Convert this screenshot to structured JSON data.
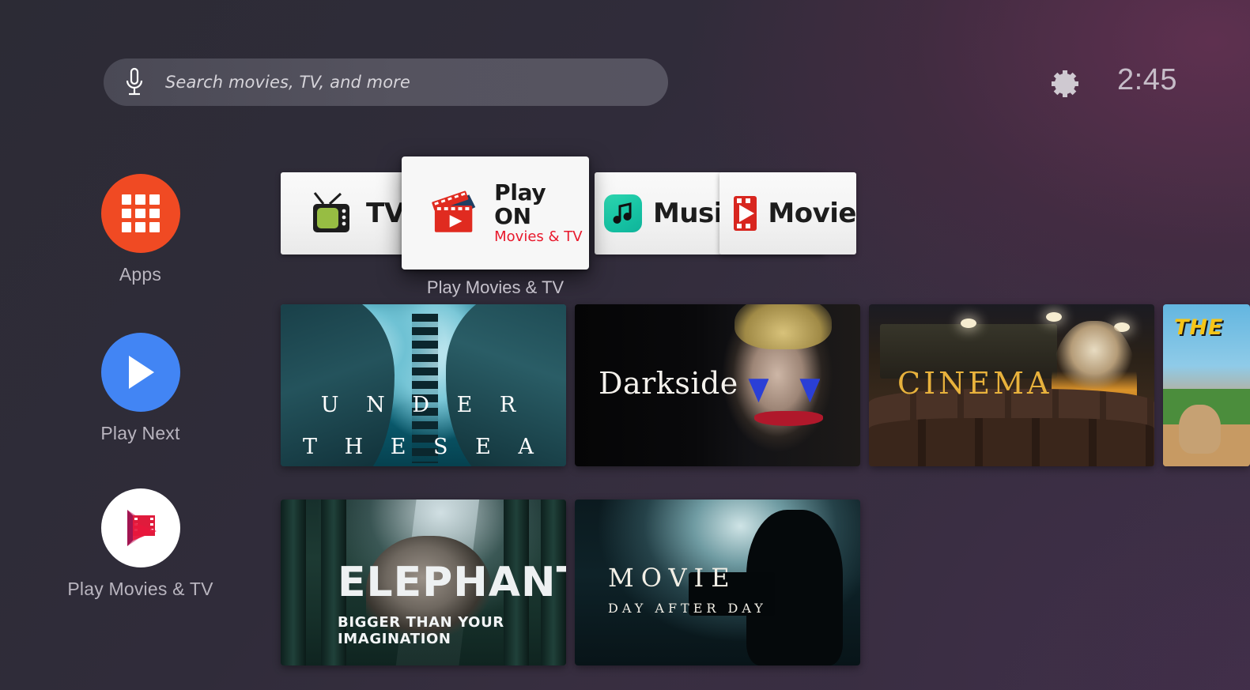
{
  "topbar": {
    "search": {
      "placeholder": "Search movies, TV, and more",
      "mic_icon": "microphone-icon"
    },
    "settings_icon": "gear-icon",
    "clock": "2:45"
  },
  "sidebar": {
    "items": [
      {
        "label": "Apps",
        "icon": "apps-grid-icon",
        "color": "#f04a23"
      },
      {
        "label": "Play Next",
        "icon": "play-triangle-icon",
        "color": "#4285f4"
      },
      {
        "label": "Play Movies & TV",
        "icon": "play-movies-logo-icon",
        "color": "#ffffff"
      }
    ]
  },
  "app_row": {
    "cards": [
      {
        "name": "tv",
        "label": "TV",
        "icon": "retro-tv-icon"
      },
      {
        "name": "music",
        "label": "Music",
        "icon": "music-note-icon"
      },
      {
        "name": "movie",
        "label": "Movie",
        "icon": "film-strip-play-icon"
      }
    ],
    "focused_card": {
      "title": "Play ON",
      "subtitle": "Movies & TV",
      "icon": "clapperboard-play-icon",
      "caption": "Play Movies & TV"
    }
  },
  "content": {
    "row1": [
      {
        "name": "under-the-sea",
        "line1": "U N D E R",
        "line2": "T H E S E A"
      },
      {
        "name": "darkside",
        "line1": "Darkside"
      },
      {
        "name": "cinema",
        "line1": "CINEMA"
      },
      {
        "name": "the-baseball",
        "line1": "THE"
      }
    ],
    "row2": [
      {
        "name": "elephant",
        "line1": "ELEPHANT",
        "line2": "BIGGER THAN YOUR IMAGINATION"
      },
      {
        "name": "movie-day-after-day",
        "line1": "MOVIE",
        "line2": "DAY AFTER DAY"
      }
    ]
  }
}
